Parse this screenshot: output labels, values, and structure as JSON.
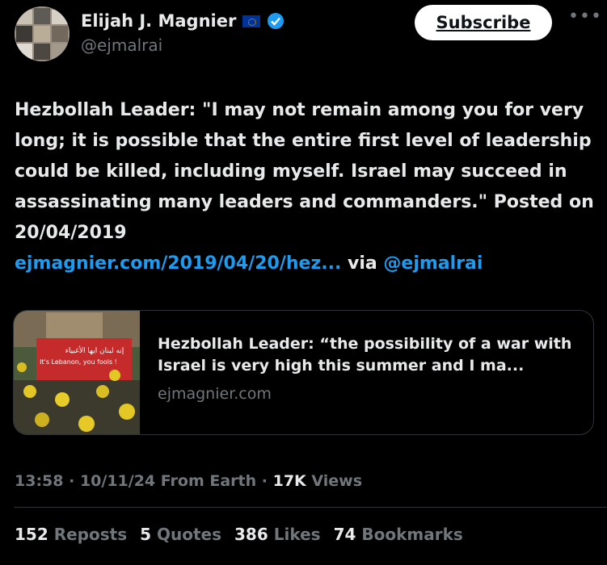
{
  "author": {
    "name": "Elijah J. Magnier",
    "handle": "@ejmalrai",
    "flag_icon": "eu-flag-icon",
    "verified_icon": "verified-badge-icon"
  },
  "actions": {
    "subscribe_label": "Subscribe",
    "more_label": "•••"
  },
  "tweet": {
    "text": "Hezbollah Leader: \"I may not remain among you for very long; it is possible that the entire first level of leadership could be killed, including myself. Israel may succeed in assassinating many leaders and commanders.\" Posted on 20/04/2019",
    "link_text": "ejmagnier.com/2019/04/20/hez...",
    "via_text": "via",
    "via_handle": "@ejmalrai"
  },
  "card": {
    "title": "Hezbollah Leader: “the possibility of a war with Israel is very high this summer and I ma...",
    "domain": "ejmagnier.com",
    "banner_text_line1": "إنه لبنان ايها الأغبياء",
    "banner_text_line2": "It's Lebanon, you fools !"
  },
  "meta": {
    "time": "13:58",
    "sep1": " · ",
    "date": "10/11/24",
    "from": " From Earth",
    "sep2": " · ",
    "views_count": "17K",
    "views_label": " Views"
  },
  "stats": {
    "reposts_count": "152",
    "reposts_label": " Reposts",
    "quotes_count": "5",
    "quotes_label": " Quotes",
    "likes_count": "386",
    "likes_label": " Likes",
    "bookmarks_count": "74",
    "bookmarks_label": " Bookmarks"
  },
  "colors": {
    "background": "#000000",
    "text": "#e7e9ea",
    "muted": "#71767b",
    "link": "#1d9bf0",
    "verified": "#1d9bf0",
    "border": "#2f3336"
  }
}
